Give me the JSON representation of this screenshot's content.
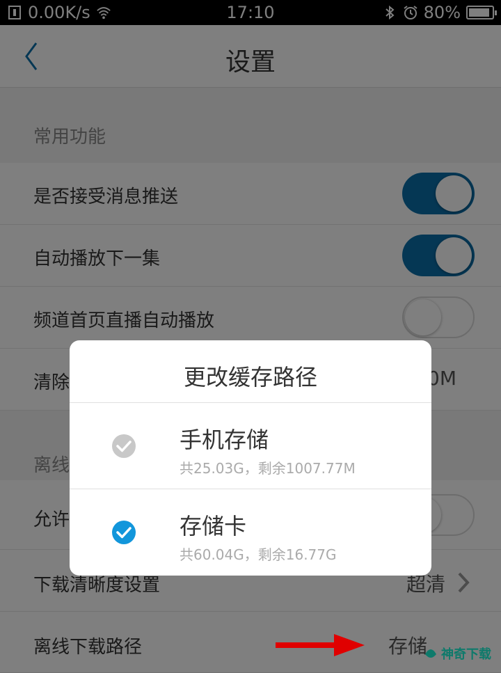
{
  "statusbar": {
    "network_speed": "0.00K/s",
    "time": "17:10",
    "battery": "80%"
  },
  "navbar": {
    "title": "设置"
  },
  "sections": {
    "common": "常用功能",
    "offline": "离线"
  },
  "rows": {
    "push": "是否接受消息推送",
    "autoplay_next": "自动播放下一集",
    "channel_autoplay": "频道首页直播自动播放",
    "clear_label": "清除",
    "clear_value": "0M",
    "allow_label": "允许",
    "quality_label": "下载清晰度设置",
    "quality_value": "超清",
    "path_label": "离线下载路径",
    "path_value": "存储"
  },
  "toggles": {
    "push": true,
    "autoplay_next": true,
    "channel_autoplay": false,
    "allow": false
  },
  "dialog": {
    "title": "更改缓存路径",
    "options": [
      {
        "name": "手机存储",
        "detail": "共25.03G，剩余1007.77M",
        "selected": false
      },
      {
        "name": "存储卡",
        "detail": "共60.04G，剩余16.77G",
        "selected": true
      }
    ]
  },
  "watermark": {
    "text": "神奇下载"
  },
  "colors": {
    "accent": "#0b6ea8",
    "check_selected": "#1296db",
    "check_unselected": "#c8c8c8",
    "arrow": "#e00000"
  }
}
